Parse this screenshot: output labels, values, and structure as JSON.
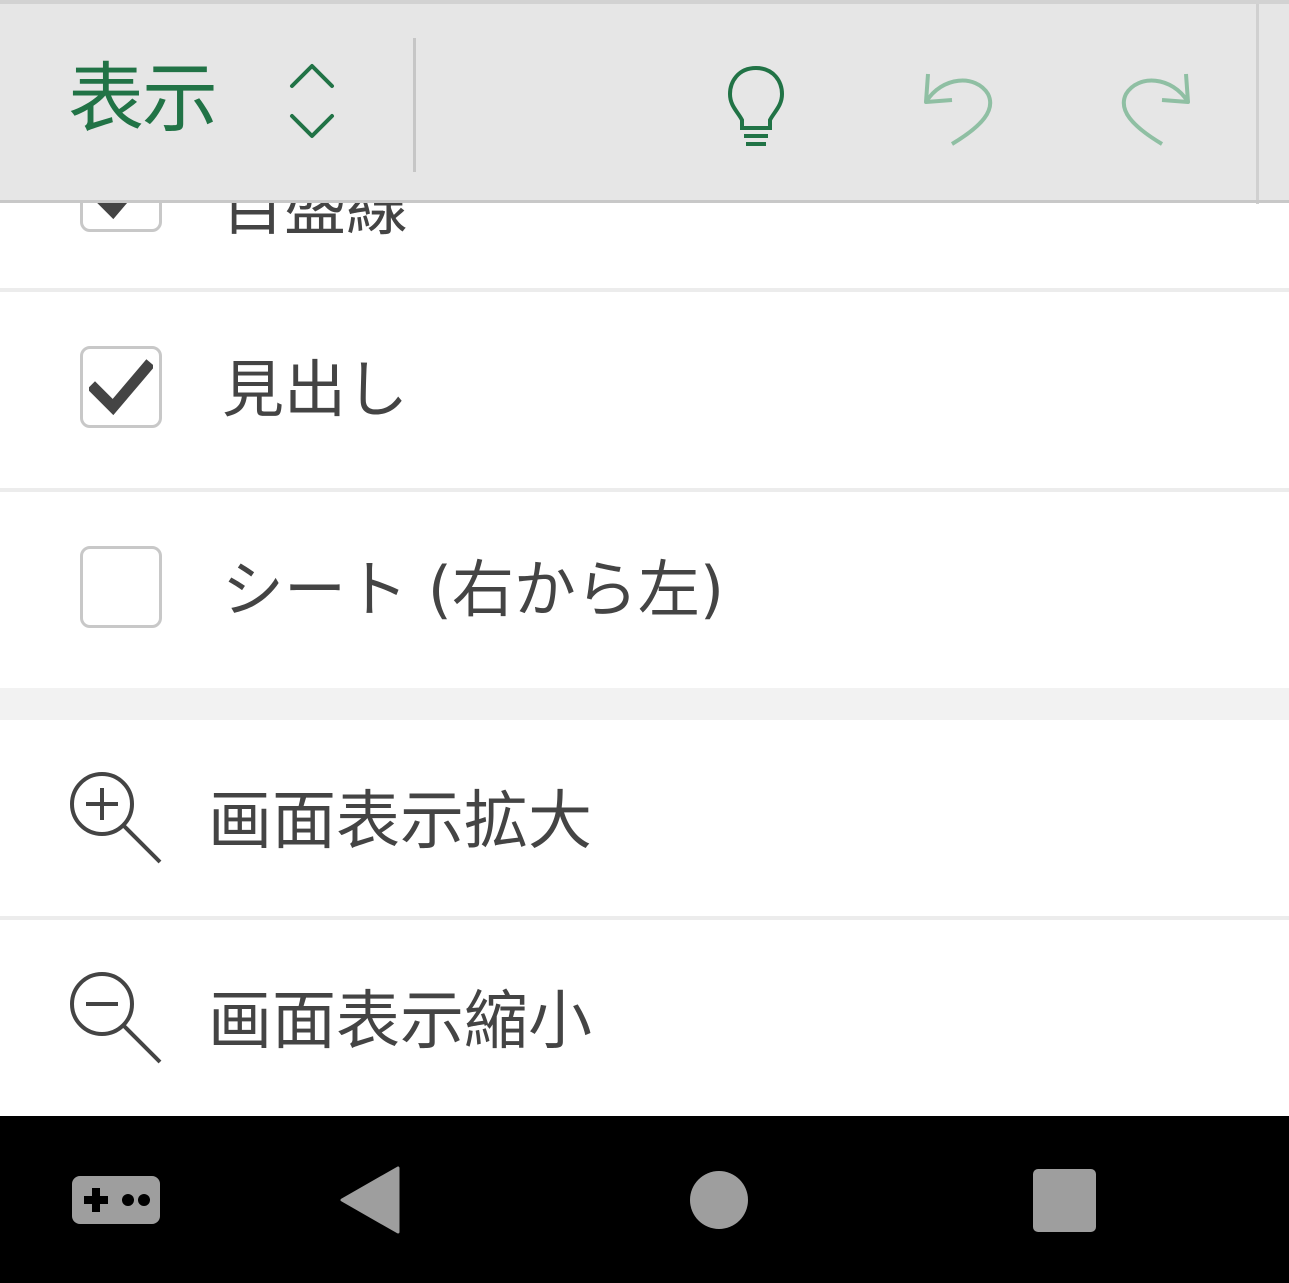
{
  "ribbon": {
    "tab_title": "表示",
    "switcher_icon": "chevron-up-down-icon",
    "buttons": [
      {
        "name": "idea",
        "icon": "lightbulb-icon"
      },
      {
        "name": "undo",
        "icon": "undo-icon"
      },
      {
        "name": "redo",
        "icon": "redo-icon"
      }
    ],
    "accent_color": "#217346",
    "disabled_color": "#8fbfa3"
  },
  "options": [
    {
      "label": "目盛線",
      "checked": true
    },
    {
      "label": "見出し",
      "checked": true
    },
    {
      "label": "シート (右から左)",
      "checked": false
    }
  ],
  "zoom": {
    "zoom_in": {
      "label": "画面表示拡大",
      "icon": "zoom-in-icon"
    },
    "zoom_out": {
      "label": "画面表示縮小",
      "icon": "zoom-out-icon"
    }
  },
  "navbar": {
    "buttons": [
      "gamepad-icon",
      "back-icon",
      "home-icon",
      "recents-icon"
    ]
  }
}
